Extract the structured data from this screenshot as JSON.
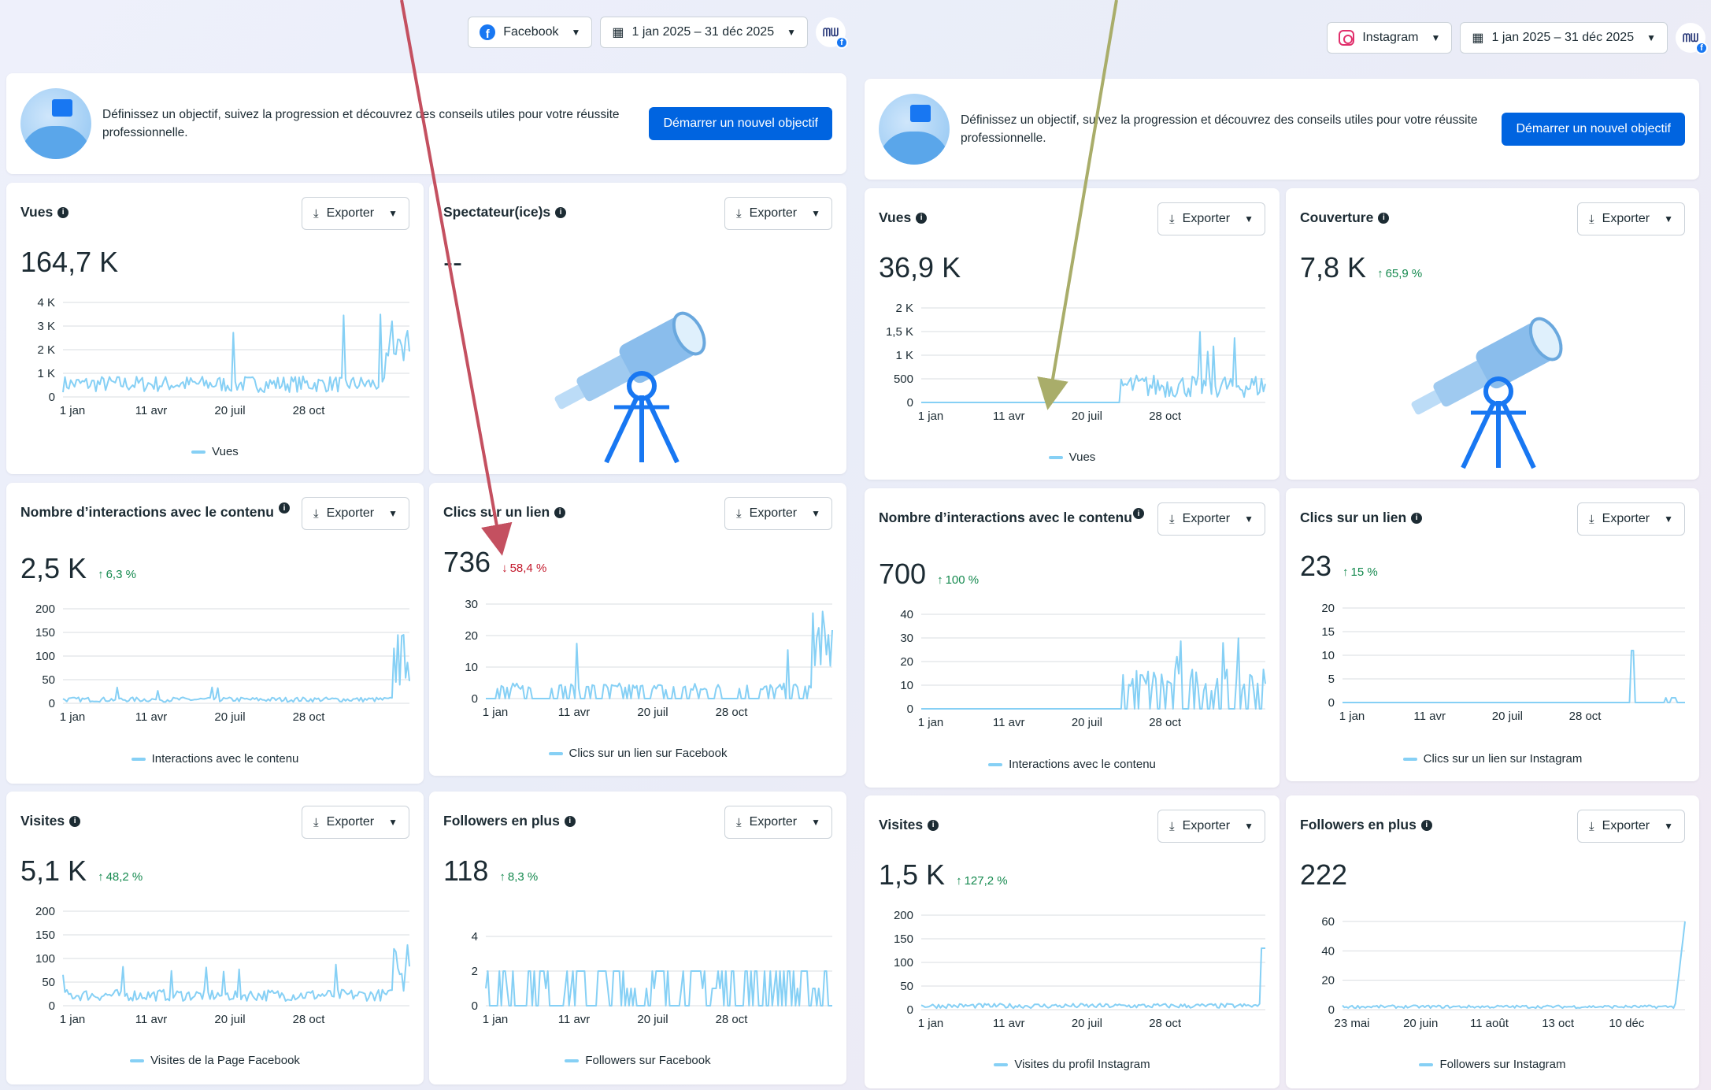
{
  "left": {
    "platform": "Facebook",
    "date_range": "1 jan 2025 – 31 déc 2025",
    "banner_text": "Définissez un objectif, suivez la progression et découvrez des conseils utiles pour votre réussite professionnelle.",
    "banner_button": "Démarrer un nouvel objectif",
    "export_label": "Exporter",
    "cards": {
      "vues": {
        "title": "Vues",
        "value": "164,7 K",
        "legend": "Vues"
      },
      "spect": {
        "title": "Spectateur(ice)s",
        "value": "--"
      },
      "inter": {
        "title": "Nombre d’interactions avec le contenu",
        "value": "2,5 K",
        "delta": "6,3 %",
        "legend": "Interactions avec le contenu"
      },
      "clics": {
        "title": "Clics sur un lien",
        "value": "736",
        "delta": "58,4 %",
        "legend": "Clics sur un lien sur Facebook"
      },
      "visites": {
        "title": "Visites",
        "value": "5,1 K",
        "delta": "48,2 %",
        "legend": "Visites de la Page Facebook"
      },
      "followers": {
        "title": "Followers en plus",
        "value": "118",
        "delta": "8,3 %",
        "legend": "Followers sur Facebook"
      }
    }
  },
  "right": {
    "platform": "Instagram",
    "date_range": "1 jan 2025 – 31 déc 2025",
    "banner_text": "Définissez un objectif, suivez la progression et découvrez des conseils utiles pour votre réussite professionnelle.",
    "banner_button": "Démarrer un nouvel objectif",
    "export_label": "Exporter",
    "cards": {
      "vues": {
        "title": "Vues",
        "value": "36,9 K",
        "legend": "Vues"
      },
      "couv": {
        "title": "Couverture",
        "value": "7,8 K",
        "delta": "65,9 %"
      },
      "inter": {
        "title": "Nombre d’interactions avec le contenu",
        "value": "700",
        "delta": "100 %",
        "legend": "Interactions avec le contenu"
      },
      "clics": {
        "title": "Clics sur un lien",
        "value": "23",
        "delta": "15 %",
        "legend": "Clics sur un lien sur Instagram"
      },
      "visites": {
        "title": "Visites",
        "value": "1,5 K",
        "delta": "127,2 %",
        "legend": "Visites du profil Instagram"
      },
      "followers": {
        "title": "Followers en plus",
        "value": "222",
        "legend": "Followers sur Instagram"
      }
    }
  },
  "colors": {
    "series": "#86d0f5",
    "accent": "#0064e0",
    "up": "#14894e",
    "down": "#c3182b",
    "arrow_left": "#c45060",
    "arrow_right": "#a9ad6a"
  },
  "chart_data": [
    {
      "id": "fb-vues",
      "type": "line",
      "y_ticks": [
        "0",
        "1 K",
        "2 K",
        "3 K",
        "4 K"
      ],
      "ylim": [
        0,
        4000
      ],
      "x_ticks": [
        "1 jan",
        "11 avr",
        "20 juil",
        "28 oct"
      ],
      "series_name": "Vues",
      "pattern": "fb-vues"
    },
    {
      "id": "fb-inter",
      "type": "line",
      "y_ticks": [
        "0",
        "50",
        "100",
        "150",
        "200"
      ],
      "ylim": [
        0,
        200
      ],
      "x_ticks": [
        "1 jan",
        "11 avr",
        "20 juil",
        "28 oct"
      ],
      "series_name": "Interactions avec le contenu",
      "pattern": "fb-inter"
    },
    {
      "id": "fb-clics",
      "type": "line",
      "y_ticks": [
        "0",
        "10",
        "20",
        "30"
      ],
      "ylim": [
        0,
        30
      ],
      "x_ticks": [
        "1 jan",
        "11 avr",
        "20 juil",
        "28 oct"
      ],
      "series_name": "Clics sur un lien sur Facebook",
      "pattern": "fb-clics"
    },
    {
      "id": "fb-visites",
      "type": "line",
      "y_ticks": [
        "0",
        "50",
        "100",
        "150",
        "200"
      ],
      "ylim": [
        0,
        200
      ],
      "x_ticks": [
        "1 jan",
        "11 avr",
        "20 juil",
        "28 oct"
      ],
      "series_name": "Visites de la Page Facebook",
      "pattern": "fb-visites"
    },
    {
      "id": "fb-followers",
      "type": "line",
      "y_ticks": [
        "0",
        "2",
        "4"
      ],
      "ylim": [
        0,
        5
      ],
      "x_ticks": [
        "1 jan",
        "11 avr",
        "20 juil",
        "28 oct"
      ],
      "series_name": "Followers sur Facebook",
      "pattern": "fb-followers"
    },
    {
      "id": "ig-vues",
      "type": "line",
      "y_ticks": [
        "0",
        "500",
        "1 K",
        "1,5 K",
        "2 K"
      ],
      "ylim": [
        0,
        2000
      ],
      "x_ticks": [
        "1 jan",
        "11 avr",
        "20 juil",
        "28 oct"
      ],
      "series_name": "Vues",
      "pattern": "ig-vues"
    },
    {
      "id": "ig-inter",
      "type": "line",
      "y_ticks": [
        "0",
        "10",
        "20",
        "30",
        "40"
      ],
      "ylim": [
        0,
        40
      ],
      "x_ticks": [
        "1 jan",
        "11 avr",
        "20 juil",
        "28 oct"
      ],
      "series_name": "Interactions avec le contenu",
      "pattern": "ig-inter"
    },
    {
      "id": "ig-clics",
      "type": "line",
      "y_ticks": [
        "0",
        "5",
        "10",
        "15",
        "20"
      ],
      "ylim": [
        0,
        20
      ],
      "x_ticks": [
        "1 jan",
        "11 avr",
        "20 juil",
        "28 oct"
      ],
      "series_name": "Clics sur un lien sur Instagram",
      "pattern": "ig-clics"
    },
    {
      "id": "ig-visites",
      "type": "line",
      "y_ticks": [
        "0",
        "50",
        "100",
        "150",
        "200"
      ],
      "ylim": [
        0,
        200
      ],
      "x_ticks": [
        "1 jan",
        "11 avr",
        "20 juil",
        "28 oct"
      ],
      "series_name": "Visites du profil Instagram",
      "pattern": "ig-visites"
    },
    {
      "id": "ig-followers",
      "type": "line",
      "y_ticks": [
        "0",
        "20",
        "40",
        "60"
      ],
      "ylim": [
        0,
        60
      ],
      "x_ticks": [
        "23 mai",
        "20 juin",
        "11 août",
        "13 oct",
        "10 déc"
      ],
      "series_name": "Followers sur Instagram",
      "pattern": "ig-followers"
    }
  ]
}
